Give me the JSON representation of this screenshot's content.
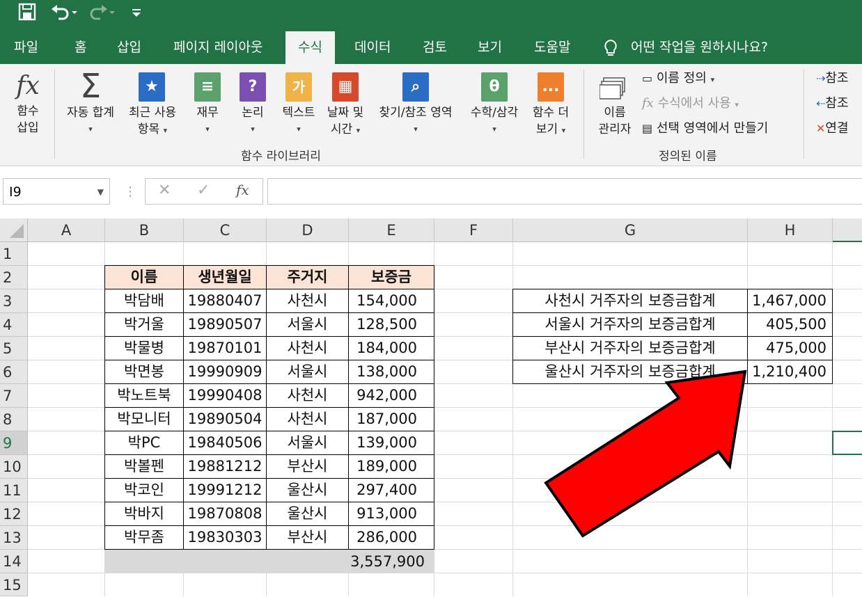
{
  "qat": {
    "save_icon": "save-icon",
    "undo_icon": "undo-icon",
    "redo_icon": "redo-icon",
    "customize_icon": "customize-icon"
  },
  "tabs": [
    "파일",
    "홈",
    "삽입",
    "페이지 레이아웃",
    "수식",
    "데이터",
    "검토",
    "보기",
    "도움말"
  ],
  "active_tab": "수식",
  "tell_me": "어떤 작업을 원하시나요?",
  "ribbon": {
    "insert_function": [
      "함수",
      "삽입"
    ],
    "autosum": "자동 합계",
    "recent": [
      "최근 사용",
      "항목"
    ],
    "financial": "재무",
    "logical": "논리",
    "text": "텍스트",
    "datetime": [
      "날짜 및",
      "시간"
    ],
    "lookup": "찾기/참조 영역",
    "math": "수학/삼각",
    "more": [
      "함수 더",
      "보기"
    ],
    "group_library": "함수 라이브러리",
    "name_manager": [
      "이름",
      "관리자"
    ],
    "define_name": "이름 정의",
    "use_in_formula": "수식에서 사용",
    "create_from_selection": "선택 영역에서 만들기",
    "group_defined": "정의된 이름",
    "trace_precedents": "참조",
    "trace_dependents": "참조",
    "remove_arrows": "연결",
    "text_icon_char": "가",
    "math_icon_char": "θ",
    "more_icon_char": "..."
  },
  "formula_bar": {
    "name_box": "I9",
    "formula": ""
  },
  "columns": [
    "A",
    "B",
    "C",
    "D",
    "E",
    "F",
    "G",
    "H"
  ],
  "rows": [
    "1",
    "2",
    "3",
    "4",
    "5",
    "6",
    "7",
    "8",
    "9",
    "10",
    "11",
    "12",
    "13",
    "14",
    "15"
  ],
  "table": {
    "headers": [
      "이름",
      "생년월일",
      "주거지",
      "보증금"
    ],
    "rows": [
      [
        "박담배",
        "19880407",
        "사천시",
        "154,000"
      ],
      [
        "박거울",
        "19890507",
        "서울시",
        "128,500"
      ],
      [
        "박물병",
        "19870101",
        "사천시",
        "184,000"
      ],
      [
        "박면봉",
        "19990909",
        "서울시",
        "138,000"
      ],
      [
        "박노트북",
        "19990408",
        "사천시",
        "942,000"
      ],
      [
        "박모니터",
        "19890504",
        "사천시",
        "187,000"
      ],
      [
        "박PC",
        "19840506",
        "서울시",
        "139,000"
      ],
      [
        "박볼펜",
        "19881212",
        "부산시",
        "189,000"
      ],
      [
        "박코인",
        "19991212",
        "울산시",
        "297,400"
      ],
      [
        "박바지",
        "19870808",
        "울산시",
        "913,000"
      ],
      [
        "박무좀",
        "19830303",
        "부산시",
        "286,000"
      ]
    ],
    "total": "3,557,900"
  },
  "summary": [
    [
      "사천시 거주자의 보증금합계",
      "1,467,000"
    ],
    [
      "서울시 거주자의 보증금합계",
      "405,500"
    ],
    [
      "부산시 거주자의 보증금합계",
      "475,000"
    ],
    [
      "울산시 거주자의 보증금합계",
      "1,210,400"
    ]
  ],
  "colors": {
    "excel_green": "#217346",
    "header_fill": "#fbe4d5",
    "arrow_red": "#ff0000"
  }
}
